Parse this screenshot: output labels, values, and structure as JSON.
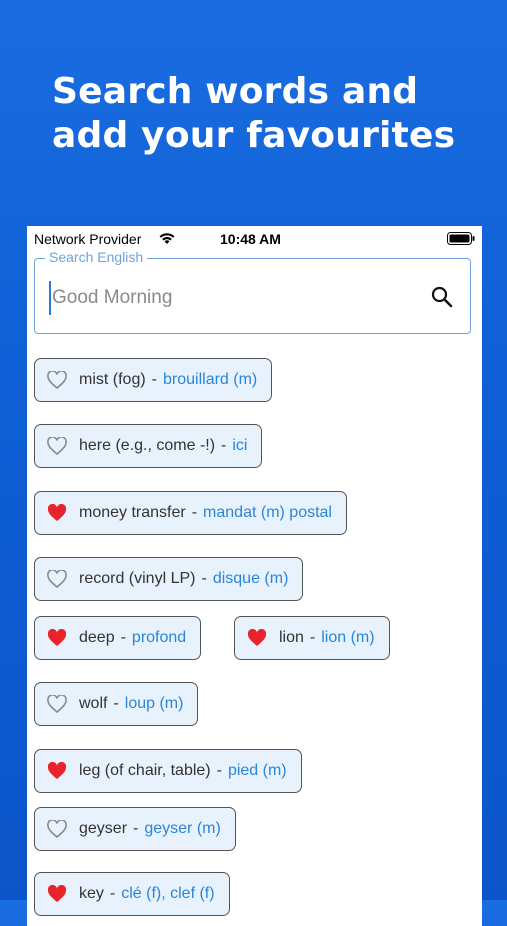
{
  "headline": "Search words and add your favourites",
  "status_bar": {
    "carrier": "Network Provider",
    "time": "10:48 AM",
    "wifi_icon": "wifi-icon",
    "battery_icon": "battery-icon"
  },
  "search": {
    "legend": "Search English",
    "placeholder": "Good Morning",
    "icon": "search-icon"
  },
  "colors": {
    "background": "#0f5fd6",
    "chip_bg": "#e8f2fc",
    "translation": "#2a86d6",
    "heart_filled": "#e8232b",
    "heart_outline": "#8a8a8a"
  },
  "sep": "-",
  "words": [
    {
      "word": "mist (fog)",
      "translation": "brouillard (m)",
      "favourite": false
    },
    {
      "word": "here (e.g., come -!)",
      "translation": "ici",
      "favourite": false
    },
    {
      "word": "money transfer",
      "translation": "mandat (m) postal",
      "favourite": true
    },
    {
      "word": "record (vinyl LP)",
      "translation": "disque (m)",
      "favourite": false
    },
    {
      "word": "deep",
      "translation": "profond",
      "favourite": true
    },
    {
      "word": "lion",
      "translation": "lion (m)",
      "favourite": true
    },
    {
      "word": "wolf",
      "translation": "loup (m)",
      "favourite": false
    },
    {
      "word": "leg (of chair, table)",
      "translation": "pied (m)",
      "favourite": true
    },
    {
      "word": "geyser",
      "translation": "geyser (m)",
      "favourite": false
    },
    {
      "word": "key",
      "translation": "clé (f), clef (f)",
      "favourite": true
    }
  ]
}
